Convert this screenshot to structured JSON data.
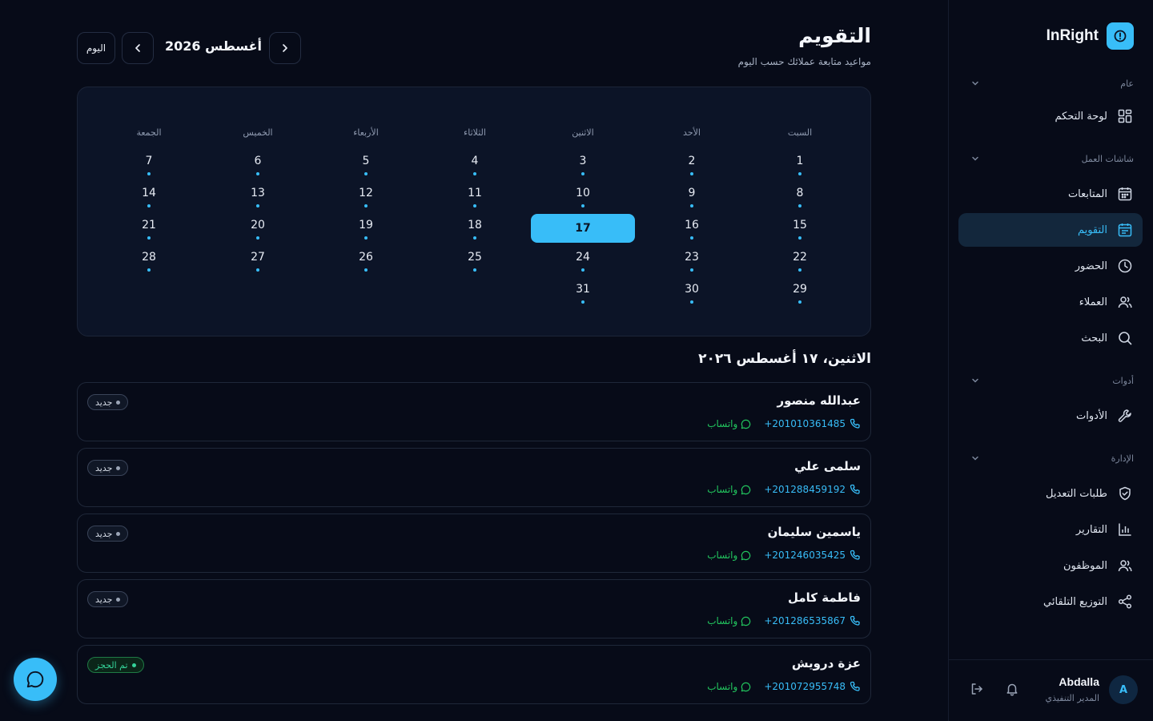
{
  "brand": {
    "name": "InRight"
  },
  "sidebar": {
    "sections": [
      {
        "label": "عام",
        "items": [
          {
            "label": "لوحة التحكم",
            "icon": "dashboard-icon"
          }
        ]
      },
      {
        "label": "شاشات العمل",
        "items": [
          {
            "label": "المتابعات",
            "icon": "calendar-icon"
          },
          {
            "label": "التقويم",
            "icon": "calendar-icon",
            "active": true
          },
          {
            "label": "الحضور",
            "icon": "clock-icon"
          },
          {
            "label": "العملاء",
            "icon": "users-icon"
          },
          {
            "label": "البحث",
            "icon": "search-icon"
          }
        ]
      },
      {
        "label": "أدوات",
        "items": [
          {
            "label": "الأدوات",
            "icon": "wrench-icon"
          }
        ]
      },
      {
        "label": "الإدارة",
        "items": [
          {
            "label": "طلبات التعديل",
            "icon": "shield-icon"
          },
          {
            "label": "التقارير",
            "icon": "chart-icon"
          },
          {
            "label": "الموظفون",
            "icon": "users-icon"
          },
          {
            "label": "التوزيع التلقائي",
            "icon": "share-icon"
          }
        ]
      }
    ],
    "user": {
      "initial": "A",
      "name": "Abdalla",
      "role": "المدير التنفيذي"
    }
  },
  "header": {
    "title": "التقويم",
    "subtitle": "مواعيد متابعة عملائك حسب اليوم",
    "month_label": "أغسطس 2026",
    "today_label": "اليوم"
  },
  "calendar": {
    "weekdays": [
      "السبت",
      "الأحد",
      "الاثنين",
      "الثلاثاء",
      "الأربعاء",
      "الخميس",
      "الجمعة"
    ],
    "weeks": [
      [
        1,
        2,
        3,
        4,
        5,
        6,
        7
      ],
      [
        8,
        9,
        10,
        11,
        12,
        13,
        14
      ],
      [
        15,
        16,
        17,
        18,
        19,
        20,
        21
      ],
      [
        22,
        23,
        24,
        25,
        26,
        27,
        28
      ],
      [
        29,
        30,
        31,
        null,
        null,
        null,
        null
      ]
    ],
    "selected_day": 17
  },
  "day_list": {
    "date_label": "الاثنين، ١٧ أغسطس ٢٠٢٦",
    "whatsapp_label": "واتساب",
    "entries": [
      {
        "name": "عبدالله منصور",
        "phone": "+201010361485",
        "status": "جديد",
        "status_type": "new"
      },
      {
        "name": "سلمى علي",
        "phone": "+201288459192",
        "status": "جديد",
        "status_type": "new"
      },
      {
        "name": "ياسمين سليمان",
        "phone": "+201246035425",
        "status": "جديد",
        "status_type": "new"
      },
      {
        "name": "فاطمة كامل",
        "phone": "+201286535867",
        "status": "جديد",
        "status_type": "new"
      },
      {
        "name": "عزة درويش",
        "phone": "+201072955748",
        "status": "تم الحجز",
        "status_type": "booked"
      }
    ]
  },
  "colors": {
    "accent": "#38bdf8",
    "background": "#070b18",
    "success": "#22c55e"
  }
}
